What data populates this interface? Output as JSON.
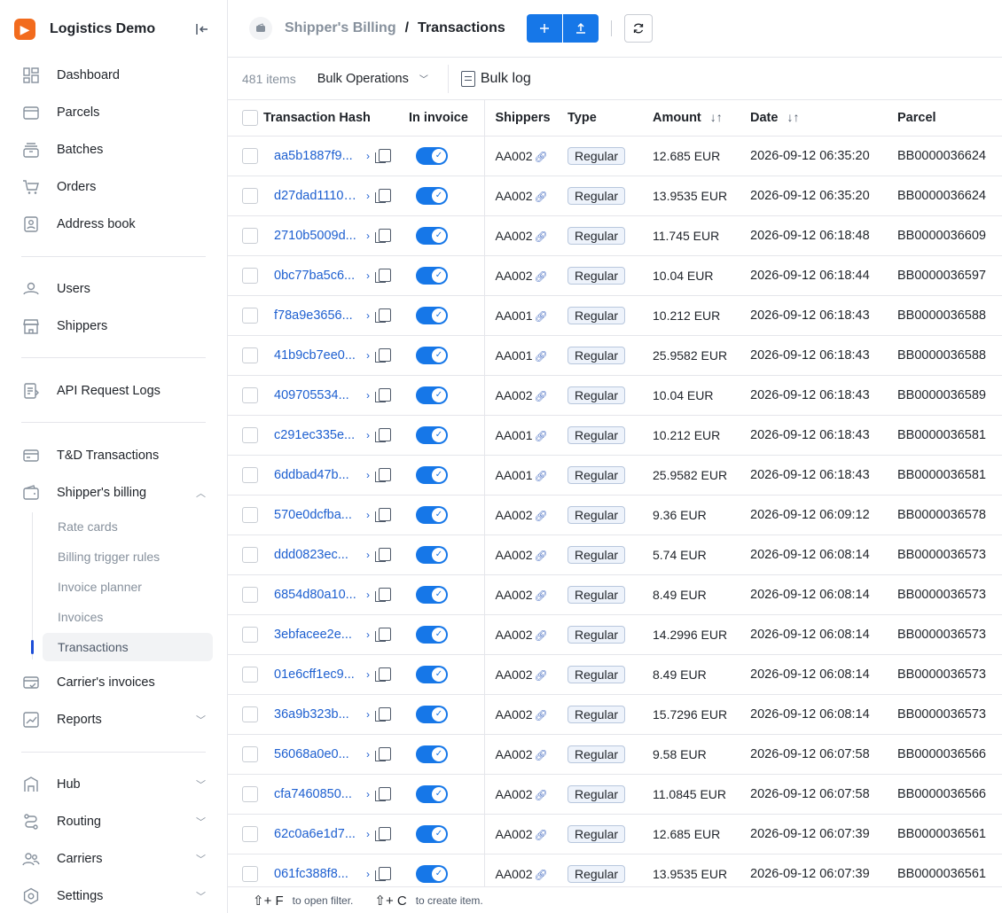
{
  "app": {
    "name": "Logistics Demo",
    "logo_glyph": "▶"
  },
  "sidebar": {
    "items": [
      {
        "key": "dashboard",
        "label": "Dashboard",
        "icon": "dashboard-icon"
      },
      {
        "key": "parcels",
        "label": "Parcels",
        "icon": "box-icon"
      },
      {
        "key": "batches",
        "label": "Batches",
        "icon": "stack-icon"
      },
      {
        "key": "orders",
        "label": "Orders",
        "icon": "cart-icon"
      },
      {
        "key": "address-book",
        "label": "Address book",
        "icon": "contact-icon"
      },
      {
        "key": "users",
        "label": "Users",
        "icon": "users-icon"
      },
      {
        "key": "shippers",
        "label": "Shippers",
        "icon": "store-icon"
      },
      {
        "key": "api-request-logs",
        "label": "API Request Logs",
        "icon": "log-icon"
      },
      {
        "key": "td-transactions",
        "label": "T&D Transactions",
        "icon": "card-icon"
      },
      {
        "key": "shippers-billing",
        "label": "Shipper's billing",
        "icon": "wallet-icon"
      },
      {
        "key": "carriers-invoices",
        "label": "Carrier's invoices",
        "icon": "invoice-icon"
      },
      {
        "key": "reports",
        "label": "Reports",
        "icon": "chart-icon"
      },
      {
        "key": "hub",
        "label": "Hub",
        "icon": "building-icon"
      },
      {
        "key": "routing",
        "label": "Routing",
        "icon": "route-icon"
      },
      {
        "key": "carriers",
        "label": "Carriers",
        "icon": "people-icon"
      },
      {
        "key": "settings",
        "label": "Settings",
        "icon": "gear-icon"
      }
    ],
    "billing_sub": [
      "Rate cards",
      "Billing trigger rules",
      "Invoice planner",
      "Invoices",
      "Transactions"
    ]
  },
  "header": {
    "parent": "Shipper's Billing",
    "separator": "/",
    "title": "Transactions"
  },
  "toolbar": {
    "count": "481 items",
    "bulk_ops": "Bulk Operations",
    "bulk_log": "Bulk log"
  },
  "table": {
    "columns": [
      "Transaction Hash",
      "In invoice",
      "Shippers",
      "Type",
      "Amount",
      "Date",
      "Parcel"
    ],
    "rows": [
      [
        "aa5b1887f9...",
        "AA002",
        "Regular",
        "12.685 EUR",
        "2026-09-12 06:35:20",
        "BB0000036624"
      ],
      [
        "d27dad11105...",
        "AA002",
        "Regular",
        "13.9535 EUR",
        "2026-09-12 06:35:20",
        "BB0000036624"
      ],
      [
        "2710b5009d...",
        "AA002",
        "Regular",
        "11.745 EUR",
        "2026-09-12 06:18:48",
        "BB0000036609"
      ],
      [
        "0bc77ba5c6...",
        "AA002",
        "Regular",
        "10.04 EUR",
        "2026-09-12 06:18:44",
        "BB0000036597"
      ],
      [
        "f78a9e3656...",
        "AA001",
        "Regular",
        "10.212 EUR",
        "2026-09-12 06:18:43",
        "BB0000036588"
      ],
      [
        "41b9cb7ee0...",
        "AA001",
        "Regular",
        "25.9582 EUR",
        "2026-09-12 06:18:43",
        "BB0000036588"
      ],
      [
        "409705534...",
        "AA002",
        "Regular",
        "10.04 EUR",
        "2026-09-12 06:18:43",
        "BB0000036589"
      ],
      [
        "c291ec335e...",
        "AA001",
        "Regular",
        "10.212 EUR",
        "2026-09-12 06:18:43",
        "BB0000036581"
      ],
      [
        "6ddbad47b...",
        "AA001",
        "Regular",
        "25.9582 EUR",
        "2026-09-12 06:18:43",
        "BB0000036581"
      ],
      [
        "570e0dcfba...",
        "AA002",
        "Regular",
        "9.36 EUR",
        "2026-09-12 06:09:12",
        "BB0000036578"
      ],
      [
        "ddd0823ec...",
        "AA002",
        "Regular",
        "5.74 EUR",
        "2026-09-12 06:08:14",
        "BB0000036573"
      ],
      [
        "6854d80a10...",
        "AA002",
        "Regular",
        "8.49 EUR",
        "2026-09-12 06:08:14",
        "BB0000036573"
      ],
      [
        "3ebfacee2e...",
        "AA002",
        "Regular",
        "14.2996 EUR",
        "2026-09-12 06:08:14",
        "BB0000036573"
      ],
      [
        "01e6cff1ec9...",
        "AA002",
        "Regular",
        "8.49 EUR",
        "2026-09-12 06:08:14",
        "BB0000036573"
      ],
      [
        "36a9b323b...",
        "AA002",
        "Regular",
        "15.7296 EUR",
        "2026-09-12 06:08:14",
        "BB0000036573"
      ],
      [
        "56068a0e0...",
        "AA002",
        "Regular",
        "9.58 EUR",
        "2026-09-12 06:07:58",
        "BB0000036566"
      ],
      [
        "cfa7460850...",
        "AA002",
        "Regular",
        "11.0845 EUR",
        "2026-09-12 06:07:58",
        "BB0000036566"
      ],
      [
        "62c0a6e1d7...",
        "AA002",
        "Regular",
        "12.685 EUR",
        "2026-09-12 06:07:39",
        "BB0000036561"
      ],
      [
        "061fc388f8...",
        "AA002",
        "Regular",
        "13.9535 EUR",
        "2026-09-12 06:07:39",
        "BB0000036561"
      ]
    ]
  },
  "footer": {
    "filter_key": "⇧+ F",
    "filter_text": "to open filter.",
    "create_key": "⇧+ C",
    "create_text": "to create item."
  },
  "colors": {
    "primary": "#1677e8",
    "link": "#1d5fd0",
    "brand": "#f26b1d"
  }
}
